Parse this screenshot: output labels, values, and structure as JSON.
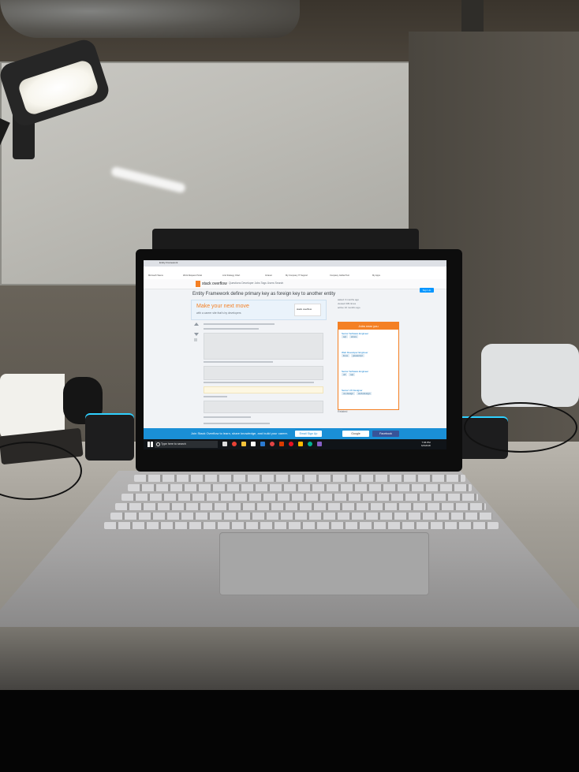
{
  "browser": {
    "tab_title": "Entity Framework",
    "bookmarks": [
      "Microsoft Teams",
      "Work Request Portal",
      "Link Strategy Chart",
      "Intranet",
      "My Company IT Support",
      "Company Global Tool",
      "My Apps"
    ]
  },
  "stackoverflow": {
    "logo_text": "stack overflow",
    "nav": "Questions   Developer Jobs   Tags   Users   Search",
    "signup_label": "Sign Up",
    "question_title": "Entity Framework define primary key as foreign key to another entity",
    "ad": {
      "headline": "Make your next move",
      "subline": "with a career site that's by developers",
      "badge": "stack overflow"
    },
    "meta": [
      "asked 3 months ago",
      "viewed 339 times",
      "active 10 months ago"
    ],
    "jobs": {
      "heading": "Jobs near you",
      "items": [
        {
          "title": "Senior Software Engineer",
          "tags": [
            "sql",
            "azure"
          ]
        },
        {
          "title": "Web Developer Engineer",
          "tags": [
            "linux",
            "javascript"
          ]
        },
        {
          "title": "Senior Software Engineer",
          "tags": [
            "c#",
            "sql"
          ]
        },
        {
          "title": "Senior UX Designer",
          "tags": [
            "ux-design",
            "web-design"
          ]
        }
      ]
    },
    "related_label": "Related",
    "cta": {
      "text": "Join Stack Overflow to learn, share knowledge, and build your career.",
      "signup": "Email Sign Up",
      "google": "Google",
      "facebook": "Facebook"
    }
  },
  "taskbar": {
    "search_placeholder": "Type here to search",
    "time": "7:06 PM",
    "date": "6/4/2018"
  }
}
